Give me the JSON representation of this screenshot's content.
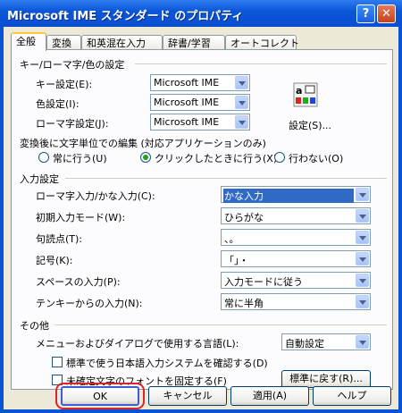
{
  "window": {
    "title": "Microsoft IME スタンダード のプロパティ"
  },
  "tabs": [
    "全般",
    "変換",
    "和英混在入力",
    "辞書/学習",
    "オートコレクト"
  ],
  "group_keys": {
    "title": "キー/ローマ字/色の設定",
    "key_label": "キー設定(E):",
    "key_value": "Microsoft IME",
    "color_label": "色設定(I):",
    "color_value": "Microsoft IME",
    "romaji_label": "ローマ字設定(J):",
    "romaji_value": "Microsoft IME",
    "settings_button": "設定(S)..."
  },
  "edit_group": {
    "title": "変換後に文字単位での編集 (対応アプリケーションのみ)",
    "options": [
      "常に行う(U)",
      "クリックしたときに行う(X)",
      "行わない(O)"
    ]
  },
  "input_group": {
    "title": "入力設定",
    "rows": [
      {
        "label": "ローマ字入力/かな入力(C):",
        "value": "かな入力"
      },
      {
        "label": "初期入力モード(W):",
        "value": "ひらがな"
      },
      {
        "label": "句読点(T):",
        "value": "、。"
      },
      {
        "label": "記号(K):",
        "value": "「」・"
      },
      {
        "label": "スペースの入力(P):",
        "value": "入力モードに従う"
      },
      {
        "label": "テンキーからの入力(N):",
        "value": "常に半角"
      }
    ]
  },
  "other_group": {
    "title": "その他",
    "lang_label": "メニューおよびダイアログで使用する言語(L):",
    "lang_value": "自動設定",
    "check1": "標準で使う日本語入力システムを確認する(D)",
    "check2": "未確定文字のフォントを固定する(F)",
    "reset_button": "標準に戻す(R)..."
  },
  "buttons": {
    "ok": "OK",
    "cancel": "キャンセル",
    "apply": "適用(A)",
    "help": "ヘルプ"
  },
  "colors": {
    "titlebar": "#0b57d8",
    "face": "#ece9d8",
    "selection": "#316ac5",
    "highlight_ring": "#d9262c"
  }
}
